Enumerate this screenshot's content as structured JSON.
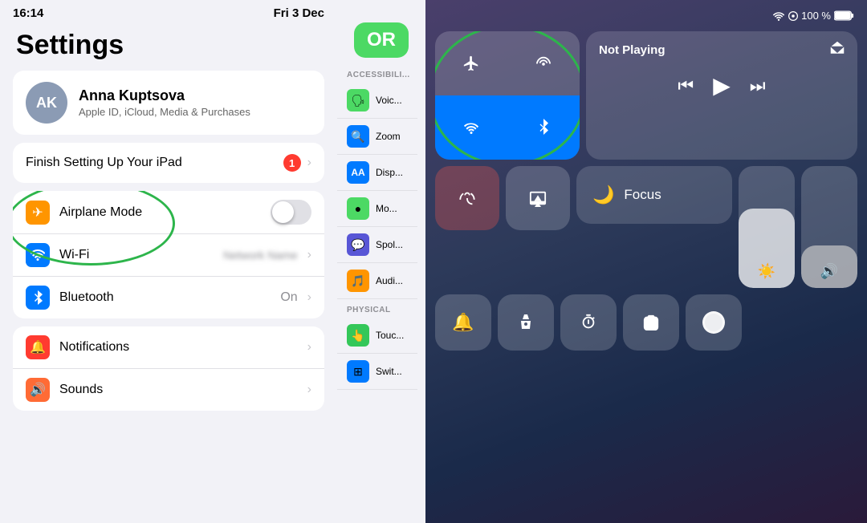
{
  "statusBar": {
    "time": "16:14",
    "date": "Fri 3 Dec"
  },
  "settings": {
    "title": "Settings",
    "user": {
      "initials": "AK",
      "name": "Anna Kuptsova",
      "subtitle": "Apple ID, iCloud, Media & Purchases"
    },
    "finishSetup": {
      "label": "Finish Setting Up Your iPad",
      "badge": "1"
    },
    "rows": [
      {
        "id": "airplane-mode",
        "label": "Airplane Mode",
        "iconColor": "icon-orange",
        "icon": "✈",
        "value": "",
        "hasToggle": true
      },
      {
        "id": "wifi",
        "label": "Wi-Fi",
        "iconColor": "icon-blue",
        "icon": "📶",
        "value": "blurred",
        "hasToggle": false
      },
      {
        "id": "bluetooth",
        "label": "Bluetooth",
        "iconColor": "icon-blue-dark",
        "icon": "🦷",
        "value": "On",
        "hasToggle": false
      }
    ],
    "rows2": [
      {
        "id": "notifications",
        "label": "Notifications",
        "iconColor": "icon-red",
        "icon": "🔔",
        "value": "",
        "hasToggle": false
      },
      {
        "id": "sounds",
        "label": "Sounds",
        "iconColor": "icon-orange2",
        "icon": "🔊",
        "value": "",
        "hasToggle": false
      }
    ]
  },
  "orBadge": {
    "label": "OR"
  },
  "accessibility": {
    "sections": [
      {
        "header": "Accessibili...",
        "items": [
          {
            "label": "Voic..."
          },
          {
            "label": "Zoom"
          },
          {
            "label": "Disp..."
          },
          {
            "label": "Mo..."
          },
          {
            "label": "Spol..."
          },
          {
            "label": "Audi..."
          }
        ]
      },
      {
        "header": "PHYSICAL",
        "items": [
          {
            "label": "Touc..."
          },
          {
            "label": "Swit..."
          }
        ]
      }
    ]
  },
  "controlCenter": {
    "statusBar": {
      "wifi": "wifi",
      "signal": "signal",
      "battery": "100 %"
    },
    "connectivity": {
      "airplaneMode": {
        "icon": "✈",
        "active": false
      },
      "hotspot": {
        "icon": "📡",
        "active": false
      },
      "wifi": {
        "icon": "wifi",
        "active": true
      },
      "bluetooth": {
        "icon": "bt",
        "active": true
      }
    },
    "nowPlaying": {
      "title": "Not Playing",
      "prevIcon": "⏮",
      "playIcon": "▶",
      "nextIcon": "⏭",
      "airplayIcon": "airplay"
    },
    "rotationLock": {
      "icon": "🔒",
      "label": "rotation-lock"
    },
    "screenMirror": {
      "icon": "mirror",
      "label": "screen-mirror"
    },
    "brightness": {
      "fillPercent": 65,
      "icon": "☀"
    },
    "volume": {
      "fillPercent": 35,
      "icon": "🔊"
    },
    "focus": {
      "icon": "🌙",
      "label": "Focus"
    },
    "bottomIcons": [
      {
        "id": "bell",
        "icon": "🔔"
      },
      {
        "id": "flashlight",
        "icon": "🔦"
      },
      {
        "id": "timer",
        "icon": "⏱"
      },
      {
        "id": "camera",
        "icon": "📷"
      }
    ],
    "screenRecord": {
      "icon": "record"
    }
  }
}
